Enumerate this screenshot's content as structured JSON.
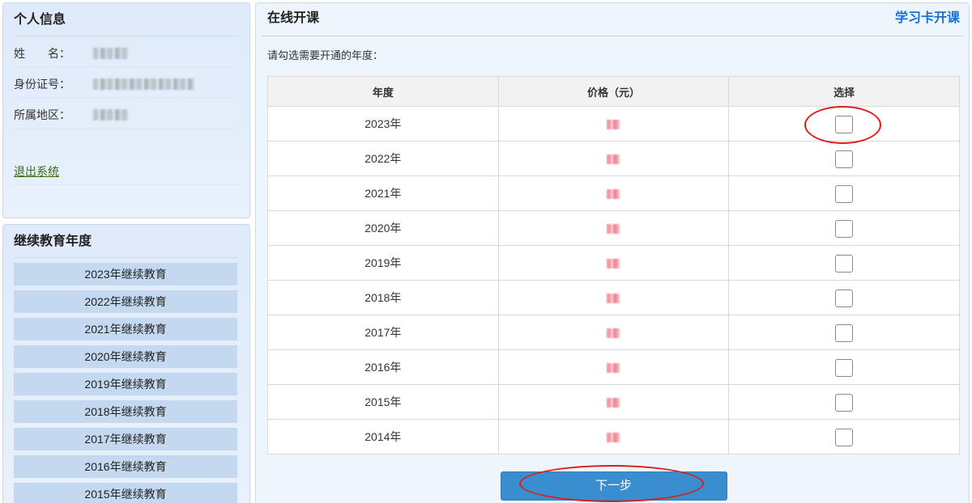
{
  "sidebar": {
    "profile": {
      "title": "个人信息",
      "fields": [
        {
          "label": "姓　　名："
        },
        {
          "label": "身份证号："
        },
        {
          "label": "所属地区："
        }
      ],
      "logout_label": "退出系统"
    },
    "education_years": {
      "title": "继续教育年度",
      "items": [
        "2023年继续教育",
        "2022年继续教育",
        "2021年继续教育",
        "2020年继续教育",
        "2019年继续教育",
        "2018年继续教育",
        "2017年继续教育",
        "2016年继续教育",
        "2015年继续教育"
      ]
    }
  },
  "main": {
    "title": "在线开课",
    "study_card_link": "学习卡开课",
    "instruction": "请勾选需要开通的年度：",
    "table": {
      "headers": {
        "year": "年度",
        "price": "价格（元）",
        "select": "选择"
      },
      "rows": [
        {
          "year": "2023年",
          "checked": false
        },
        {
          "year": "2022年",
          "checked": false
        },
        {
          "year": "2021年",
          "checked": false
        },
        {
          "year": "2020年",
          "checked": false
        },
        {
          "year": "2019年",
          "checked": false
        },
        {
          "year": "2018年",
          "checked": false
        },
        {
          "year": "2017年",
          "checked": false
        },
        {
          "year": "2016年",
          "checked": false
        },
        {
          "year": "2015年",
          "checked": false
        },
        {
          "year": "2014年",
          "checked": false
        }
      ]
    },
    "next_button_label": "下一步"
  },
  "colors": {
    "accent": "#1a6fd6",
    "btn": "#3a8ed0",
    "anno": "#dd1c1c",
    "logout": "#3a6a14",
    "item": "#c4d8ef"
  }
}
